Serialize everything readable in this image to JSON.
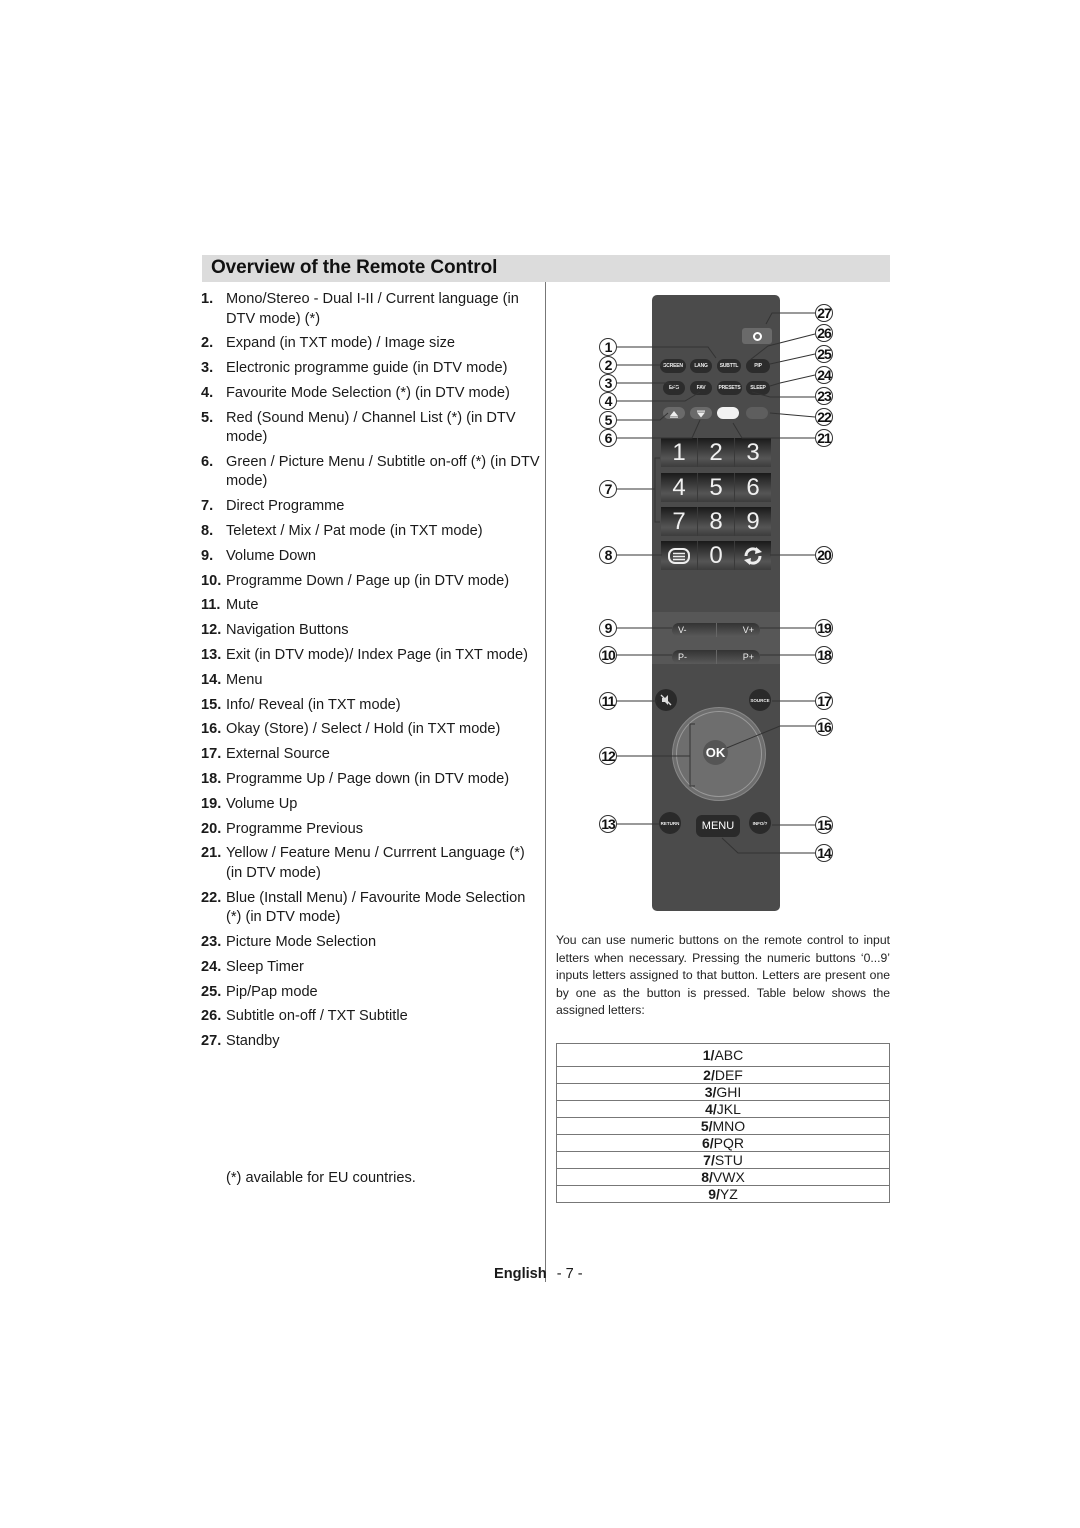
{
  "page": {
    "title": "Overview of the Remote Control",
    "footer_language": "English",
    "footer_page": "- 7 -"
  },
  "items": [
    {
      "num": "1.",
      "text": "Mono/Stereo - Dual I-II / Current language (in DTV mode) (*)"
    },
    {
      "num": "2.",
      "text": "Expand (in TXT mode) / Image size"
    },
    {
      "num": "3.",
      "text": "Electronic programme guide (in DTV mode)"
    },
    {
      "num": "4.",
      "text": "Favourite Mode Selection (*) (in DTV mode)"
    },
    {
      "num": "5.",
      "text": "Red (Sound Menu) / Channel List (*) (in DTV mode)"
    },
    {
      "num": "6.",
      "text": "Green / Picture Menu / Subtitle on-off (*) (in DTV mode)"
    },
    {
      "num": "7.",
      "text": "Direct Programme"
    },
    {
      "num": "8.",
      "text": "Teletext  / Mix / Pat  mode (in TXT mode)"
    },
    {
      "num": "9.",
      "text": "Volume Down"
    },
    {
      "num": "10.",
      "text": "Programme Down / Page up (in DTV mode)"
    },
    {
      "num": "11.",
      "text": "Mute"
    },
    {
      "num": "12.",
      "text": "Navigation Buttons"
    },
    {
      "num": "13.",
      "text": "Exit (in DTV mode)/ Index Page (in TXT mode)"
    },
    {
      "num": "14.",
      "text": "Menu"
    },
    {
      "num": "15.",
      "text": "Info/ Reveal (in TXT mode)"
    },
    {
      "num": "16.",
      "text": "Okay (Store) / Select / Hold (in TXT mode)"
    },
    {
      "num": "17.",
      "text": "External Source"
    },
    {
      "num": "18.",
      "text": "Programme Up / Page down (in DTV mode)"
    },
    {
      "num": "19.",
      "text": "Volume Up"
    },
    {
      "num": "20.",
      "text": "Programme Previous"
    },
    {
      "num": "21.",
      "text": "Yellow / Feature Menu / Currrent Language (*) (in DTV mode)"
    },
    {
      "num": "22.",
      "text": "Blue (Install Menu) / Favourite Mode Selection (*) (in DTV mode)"
    },
    {
      "num": "23.",
      "text": "Picture Mode Selection"
    },
    {
      "num": "24.",
      "text": "Sleep Timer"
    },
    {
      "num": "25.",
      "text": "Pip/Pap mode"
    },
    {
      "num": "26.",
      "text": "Subtitle on-off / TXT Subtitle"
    },
    {
      "num": "27.",
      "text": "Standby"
    }
  ],
  "footnote": "(*) available for EU countries.",
  "remote": {
    "buttons_row1": [
      "SCREEN",
      "LANG",
      "SUBTTL",
      "PIP"
    ],
    "buttons_row2": [
      "EPG",
      "FAV",
      "PRESETS",
      "SLEEP"
    ],
    "color_keys": {
      "red": "#6a6a6a",
      "green": "#6a6a6a",
      "yellow": "#f2f2f2",
      "blue": "#5e5e5e"
    },
    "numpad": [
      [
        "1",
        "2",
        "3"
      ],
      [
        "4",
        "5",
        "6"
      ],
      [
        "7",
        "8",
        "9"
      ]
    ],
    "zero": "0",
    "vol_minus": "V-",
    "vol_plus": "V+",
    "prog_minus": "P-",
    "prog_plus": "P+",
    "source": "SOURCE",
    "ok": "OK",
    "return": "RETURN",
    "menu": "MENU",
    "info": "INFO/?"
  },
  "callouts": [
    "1",
    "2",
    "3",
    "4",
    "5",
    "6",
    "7",
    "8",
    "9",
    "10",
    "11",
    "12",
    "13",
    "14",
    "15",
    "16",
    "17",
    "18",
    "19",
    "20",
    "21",
    "22",
    "23",
    "24",
    "25",
    "26",
    "27"
  ],
  "letters_intro": "You can use numeric buttons on the remote control to input letters when necessary. Pressing the numeric buttons ‘0...9’ inputs letters assigned to that button. Letters are present one by one as the button is pressed. Table below shows the assigned letters:",
  "letters_table": [
    {
      "key": "1/",
      "letters": "ABC"
    },
    {
      "key": "2/",
      "letters": "DEF"
    },
    {
      "key": "3/",
      "letters": "GHI"
    },
    {
      "key": "4/",
      "letters": "JKL"
    },
    {
      "key": "5/",
      "letters": "MNO"
    },
    {
      "key": "6/",
      "letters": "PQR"
    },
    {
      "key": "7/",
      "letters": "STU"
    },
    {
      "key": "8/",
      "letters": "VWX"
    },
    {
      "key": "9/",
      "letters": "YZ"
    }
  ]
}
